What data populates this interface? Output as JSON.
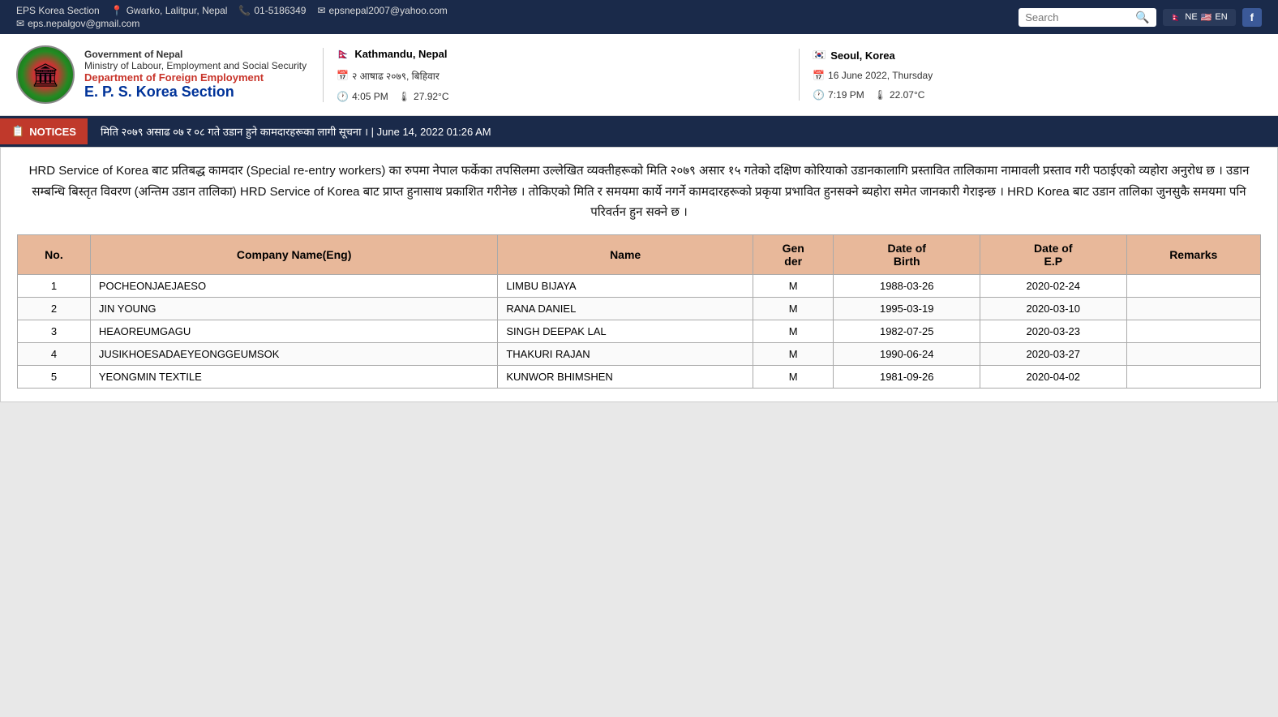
{
  "topbar": {
    "section": "EPS Korea Section",
    "location": "Gwarko, Lalitpur, Nepal",
    "phone": "01-5186349",
    "email1": "epsnepal2007@yahoo.com",
    "email2": "eps.nepalgov@gmail.com",
    "search_placeholder": "Search",
    "lang_ne": "NE",
    "lang_en": "EN",
    "fb": "f"
  },
  "header": {
    "govt": "Government of Nepal",
    "ministry": "Ministry of Labour, Employment and Social Security",
    "dept": "Department of Foreign Employment",
    "eps": "E. P. S. Korea Section",
    "location1": "Kathmandu, Nepal",
    "location2": "Seoul, Korea",
    "date_np": "२ आषाढ २०७९, बिहिवार",
    "date_en": "16 June 2022, Thursday",
    "time1": "4:05 PM",
    "temp1": "27.92°C",
    "time2": "7:19 PM",
    "temp2": "22.07°C"
  },
  "notices": {
    "label": "NOTICES",
    "text": "मिति २०७९ असाढ ०७ र ०८ गते उडान हुने कामदारहरूका लागी सूचना ।  |  June 14, 2022 01:26 AM"
  },
  "notice_body": "HRD Service of Korea बाट प्रतिबद्ध कामदार (Special re-entry workers) का रुपमा नेपाल फर्केका तपसिलमा उल्लेखित व्यक्तीहरूको मिति २०७९ असार १५ गतेको दक्षिण कोरियाको उडानकालागि प्रस्तावित तालिकामा नामावली प्रस्ताव गरी पठाईएको व्यहोरा अनुरोध छ । उडान सम्बन्धि बिस्तृत विवरण (अन्तिम उडान तालिका) HRD Service of Korea बाट प्राप्त हुनासाथ प्रकाशित गरीनेछ । तोकिएको मिति र समयमा कार्ये नगर्ने कामदारहरूको प्रकृया प्रभावित हुनसक्ने ब्यहोरा समेत जानकारी गेराइन्छ । HRD Korea बाट उडान तालिका जुनसुकै समयमा पनि परिवर्तन हुन सक्ने छ ।",
  "table": {
    "headers": [
      "No.",
      "Company Name(Eng)",
      "Name",
      "Gen\nder",
      "Date of\nBirth",
      "Date of\nE.P",
      "Remarks"
    ],
    "rows": [
      {
        "no": 1,
        "company": "POCHEONJAEJAESO",
        "name": "LIMBU BIJAYA",
        "gender": "M",
        "dob": "1988-03-26",
        "dep": "2020-02-24",
        "remarks": ""
      },
      {
        "no": 2,
        "company": "JIN YOUNG",
        "name": "RANA DANIEL",
        "gender": "M",
        "dob": "1995-03-19",
        "dep": "2020-03-10",
        "remarks": ""
      },
      {
        "no": 3,
        "company": "HEAOREUMGAGU",
        "name": "SINGH DEEPAK LAL",
        "gender": "M",
        "dob": "1982-07-25",
        "dep": "2020-03-23",
        "remarks": ""
      },
      {
        "no": 4,
        "company": "JUSIKHOESADAEYEONGGEUMSOK",
        "name": "THAKURI RAJAN",
        "gender": "M",
        "dob": "1990-06-24",
        "dep": "2020-03-27",
        "remarks": ""
      },
      {
        "no": 5,
        "company": "YEONGMIN TEXTILE",
        "name": "KUNWOR BHIMSHEN",
        "gender": "M",
        "dob": "1981-09-26",
        "dep": "2020-04-02",
        "remarks": ""
      }
    ]
  }
}
